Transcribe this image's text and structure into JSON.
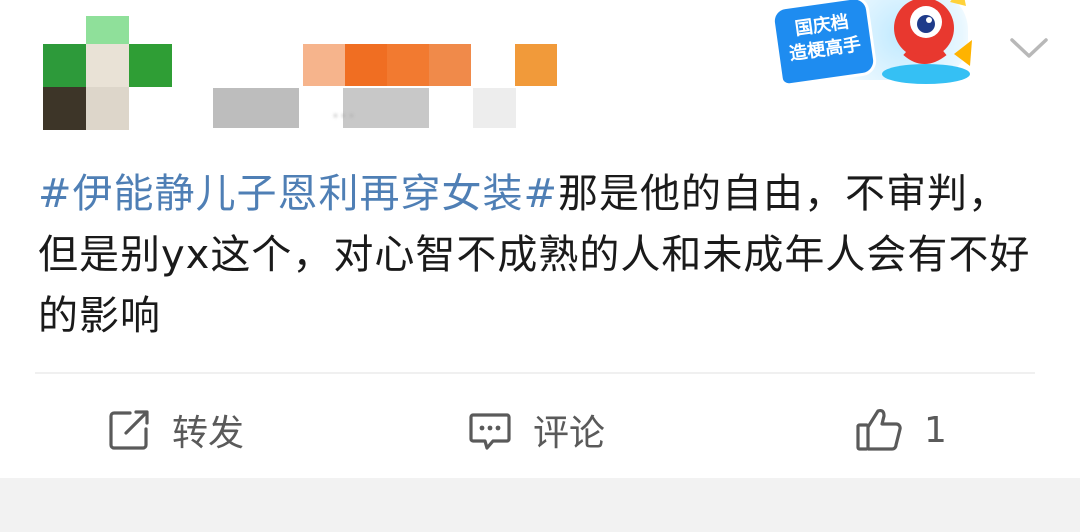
{
  "header": {
    "avatar_icon": "avatar-pixelated",
    "username": "",
    "meta_text": "...",
    "menu_icon": "chevron-down-icon"
  },
  "badge": {
    "line1": "国庆档",
    "line2": "造梗高手",
    "icon": "mascot-icon",
    "colors": {
      "badge_blue": "#1e8cf0",
      "mascot_red": "#e8382f"
    }
  },
  "content": {
    "topic": "#伊能静儿子恩利再穿女装#",
    "text": "那是他的自由，不审判，但是别yx这个，对心智不成熟的人和未成年人会有不好的影响"
  },
  "actions": {
    "repost": {
      "label": "转发",
      "icon": "repost-icon"
    },
    "comment": {
      "label": "评论",
      "icon": "comment-icon"
    },
    "like": {
      "count": "1",
      "icon": "thumbs-up-icon"
    }
  },
  "colors": {
    "topic": "#4f7fb5",
    "text": "#1a1a1a",
    "action": "#5a5a5a",
    "footer_bg": "#f2f2f2"
  }
}
